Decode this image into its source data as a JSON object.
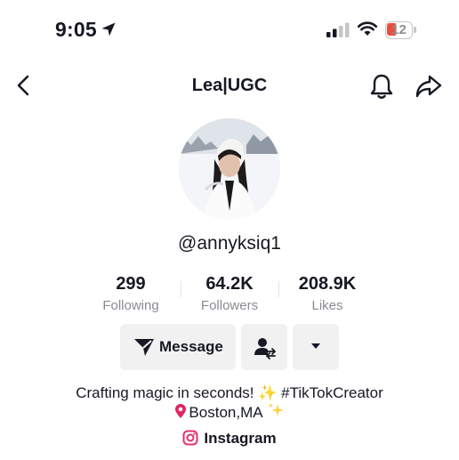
{
  "status_bar": {
    "time": "9:05",
    "battery_level": "12",
    "icons": [
      "location-arrow-icon",
      "signal-icon",
      "wifi-icon",
      "battery-icon"
    ]
  },
  "nav": {
    "title": "Lea|UGC",
    "icons": [
      "back-chevron-icon",
      "bell-icon",
      "share-icon"
    ]
  },
  "profile": {
    "username": "@annyksiq1",
    "stats": [
      {
        "value": "299",
        "label": "Following"
      },
      {
        "value": "64.2K",
        "label": "Followers"
      },
      {
        "value": "208.9K",
        "label": "Likes"
      }
    ],
    "buttons": {
      "message": "Message",
      "icons": [
        "send-icon",
        "friend-swap-icon",
        "dropdown-caret-icon"
      ]
    },
    "bio": {
      "line1_text": "Crafting magic in seconds! ✨ #TikTokCreator",
      "line2_text": "Boston,MA"
    },
    "link": {
      "label": "Instagram",
      "icon": "instagram-icon"
    }
  },
  "colors": {
    "text": "#161823",
    "secondary_text": "#8a8b91",
    "button_bg": "#f1f1f2",
    "battery_low": "#eb4e3d",
    "instagram": "#e1306c"
  }
}
